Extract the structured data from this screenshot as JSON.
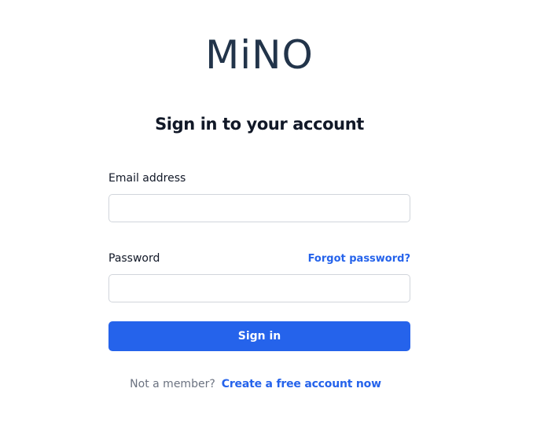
{
  "brand": {
    "logo_text": "MiNO"
  },
  "heading": "Sign in to your account",
  "form": {
    "email_label": "Email address",
    "email_value": "",
    "password_label": "Password",
    "password_value": "",
    "forgot_password_label": "Forgot password?",
    "submit_label": "Sign in"
  },
  "footer": {
    "prompt_text": "Not a member?",
    "signup_link_label": "Create a free account now"
  },
  "colors": {
    "accent": "#2563eb",
    "logo": "#22344a",
    "heading": "#111827",
    "muted": "#6b7280",
    "input_border": "#d1d5db"
  }
}
